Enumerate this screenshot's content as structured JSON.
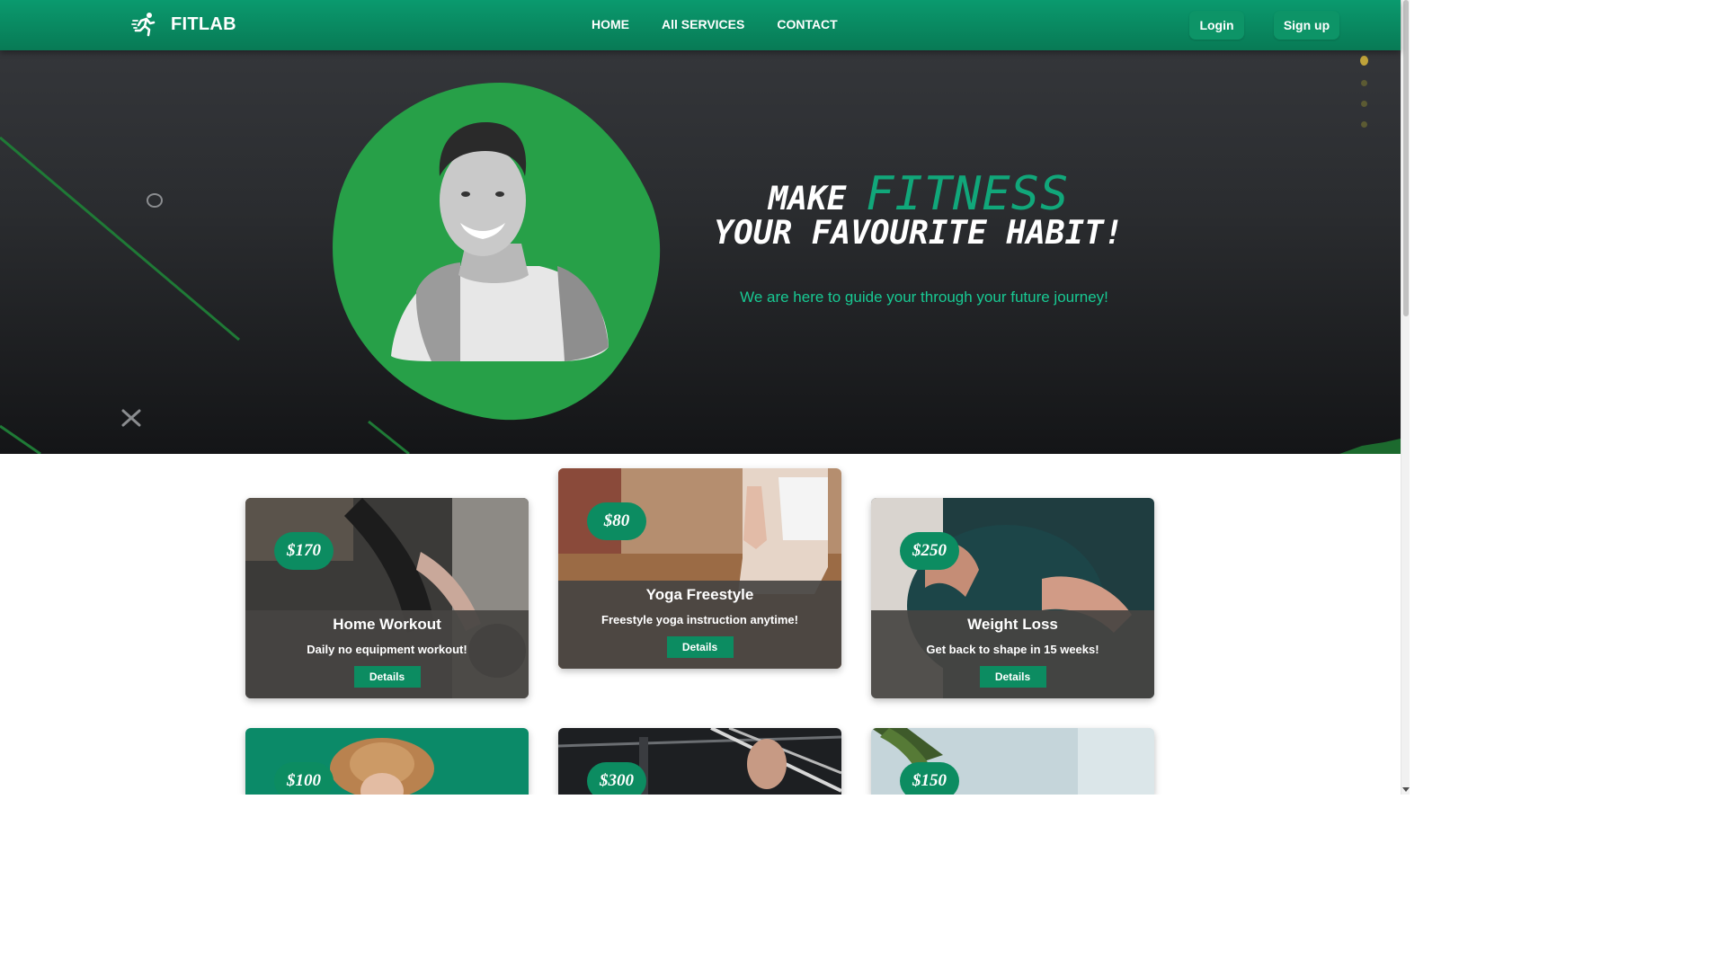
{
  "brand": {
    "name": "FITLAB",
    "icon": "running-person-icon"
  },
  "nav": {
    "links": [
      "HOME",
      "All SERVICES",
      "CONTACT"
    ],
    "login": "Login",
    "signup": "Sign up"
  },
  "hero": {
    "make": "MAKE",
    "fitness": "FITNESS",
    "line2": "YOUR FAVOURITE HABIT!",
    "subtitle": "We are here to guide your through your future journey!"
  },
  "cards": [
    {
      "price": "$170",
      "title": "Home Workout",
      "desc": "Daily no equipment workout!",
      "button": "Details"
    },
    {
      "price": "$80",
      "title": "Yoga Freestyle",
      "desc": "Freestyle yoga instruction anytime!",
      "button": "Details"
    },
    {
      "price": "$250",
      "title": "Weight Loss",
      "desc": "Get back to shape in 15 weeks!",
      "button": "Details"
    },
    {
      "price": "$100"
    },
    {
      "price": "$300"
    },
    {
      "price": "$150"
    }
  ],
  "colors": {
    "brand": "#0a9a6e",
    "accent": "#11a77a",
    "blob": "#27a048",
    "hero_bg": "#2a2c2f"
  }
}
